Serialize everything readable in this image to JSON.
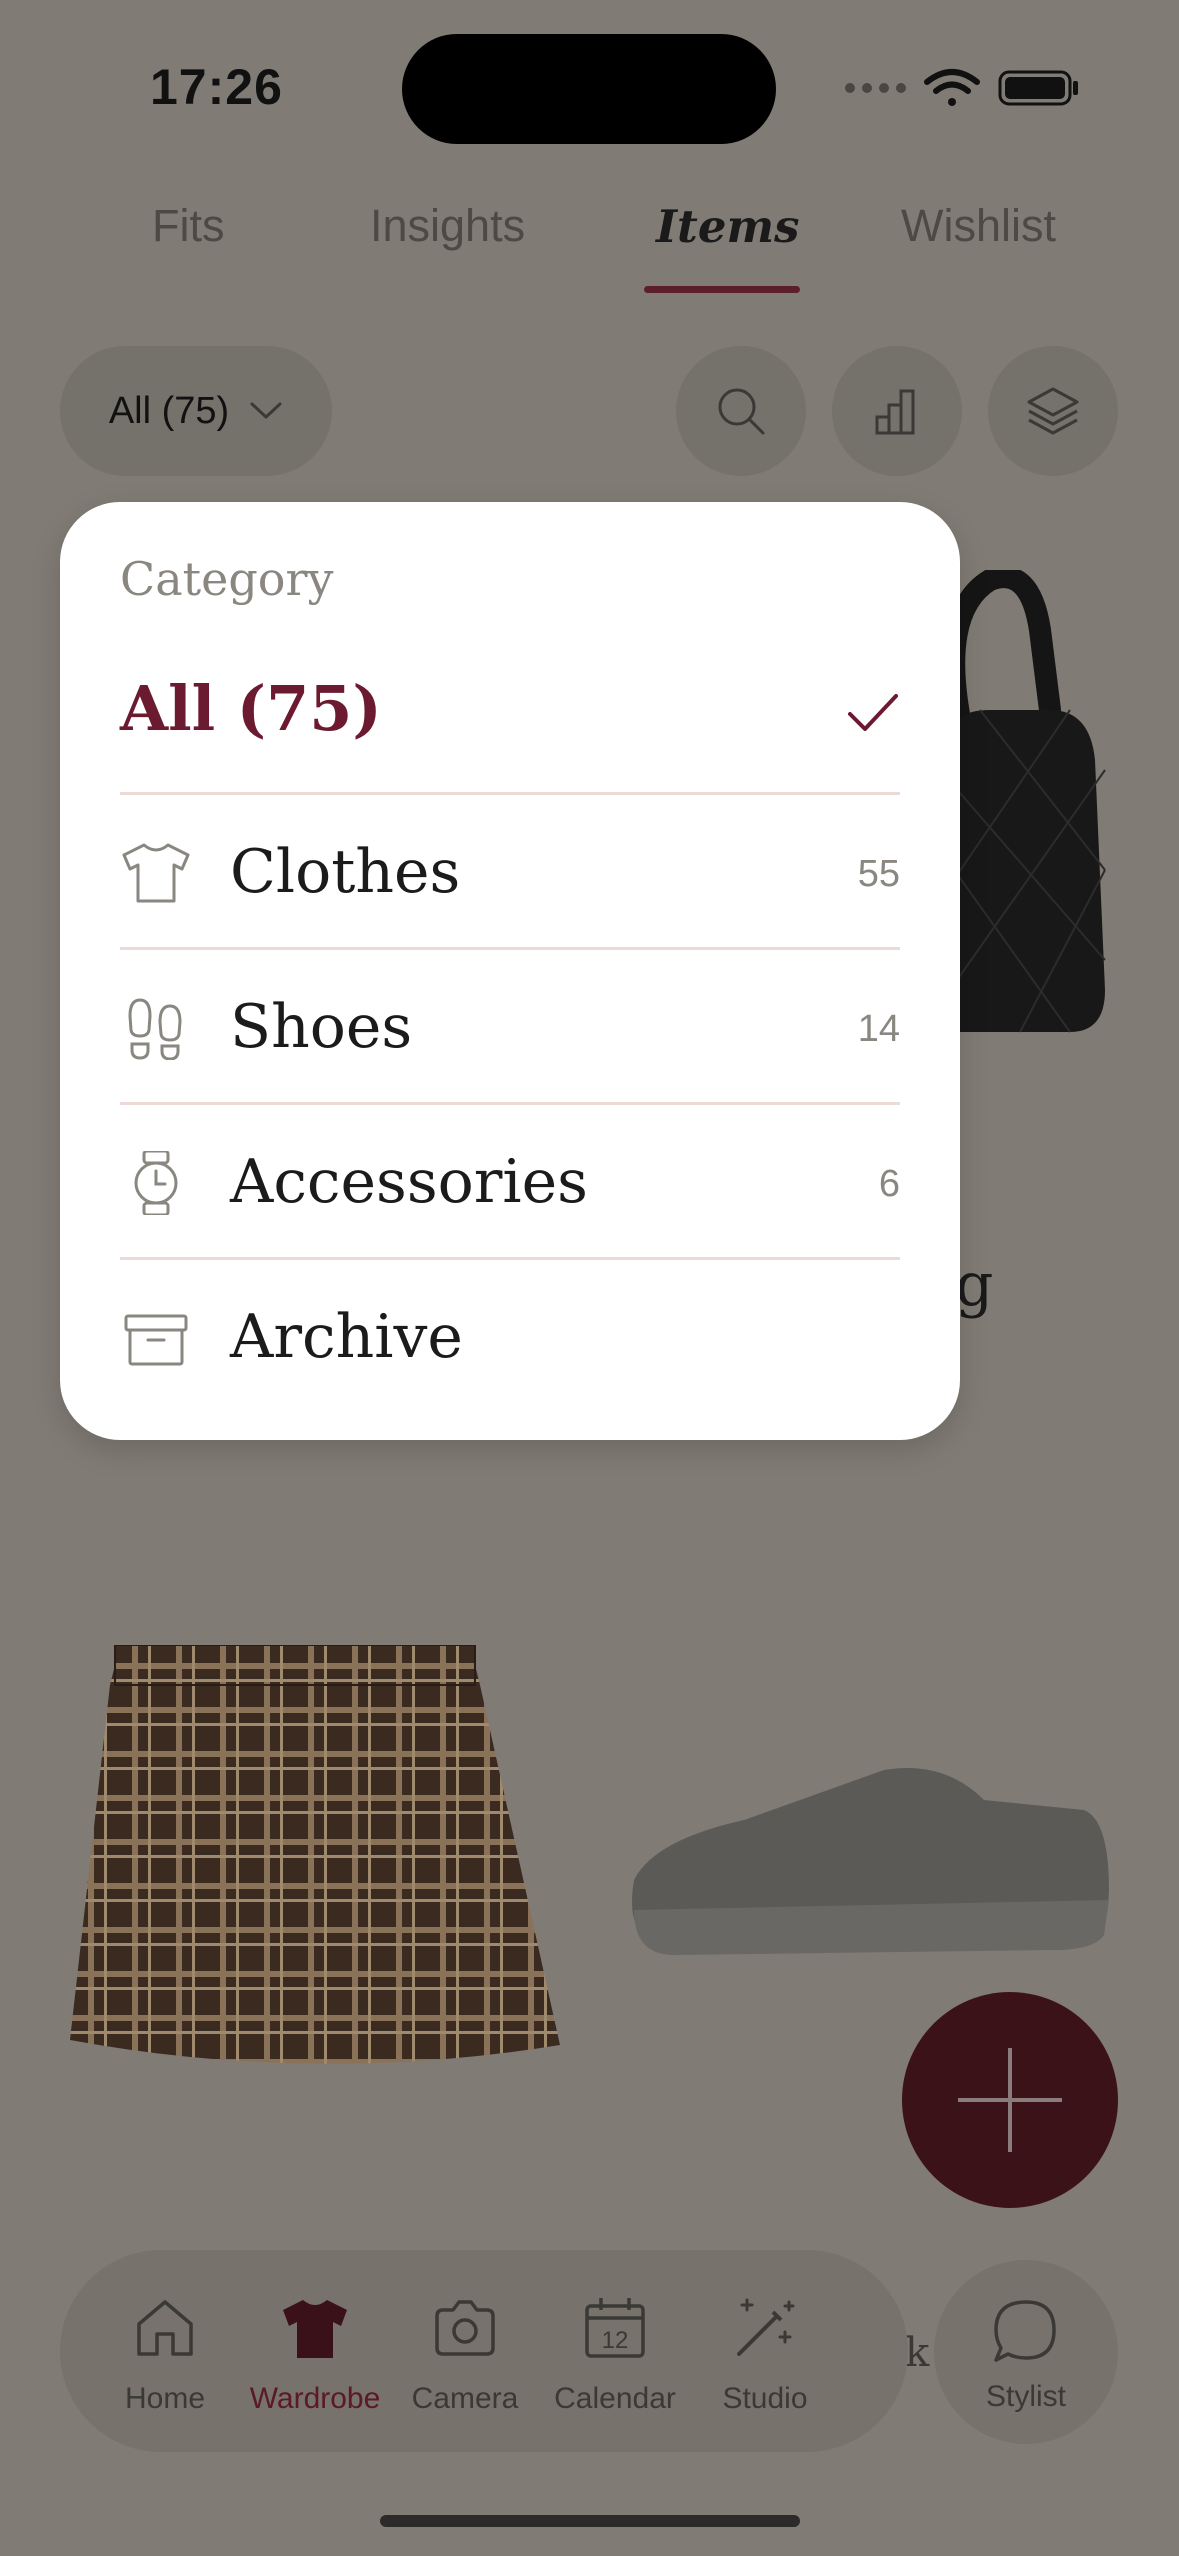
{
  "status": {
    "time": "17:26"
  },
  "tabs": [
    {
      "label": "Fits"
    },
    {
      "label": "Insights"
    },
    {
      "label": "Items"
    },
    {
      "label": "Wishlist"
    }
  ],
  "filter": {
    "label": "All (75)"
  },
  "menu": {
    "title": "Category",
    "selected": "All (75)",
    "rows": [
      {
        "label": "Clothes",
        "count": "55",
        "icon": "tshirt-icon"
      },
      {
        "label": "Shoes",
        "count": "14",
        "icon": "footprints-icon"
      },
      {
        "label": "Accessories",
        "count": "6",
        "icon": "watch-icon"
      },
      {
        "label": "Archive",
        "count": "",
        "icon": "archive-box-icon"
      }
    ]
  },
  "background": {
    "partial_caption_1": "g",
    "partial_caption_2": "k"
  },
  "nav": {
    "items": [
      {
        "label": "Home"
      },
      {
        "label": "Wardrobe"
      },
      {
        "label": "Camera"
      },
      {
        "label": "Calendar"
      },
      {
        "label": "Studio"
      }
    ],
    "calendar_day": "12",
    "stylist": "Stylist"
  },
  "colors": {
    "accent": "#6b1a30",
    "fab": "#3c1219",
    "scrim": "#807b74"
  }
}
